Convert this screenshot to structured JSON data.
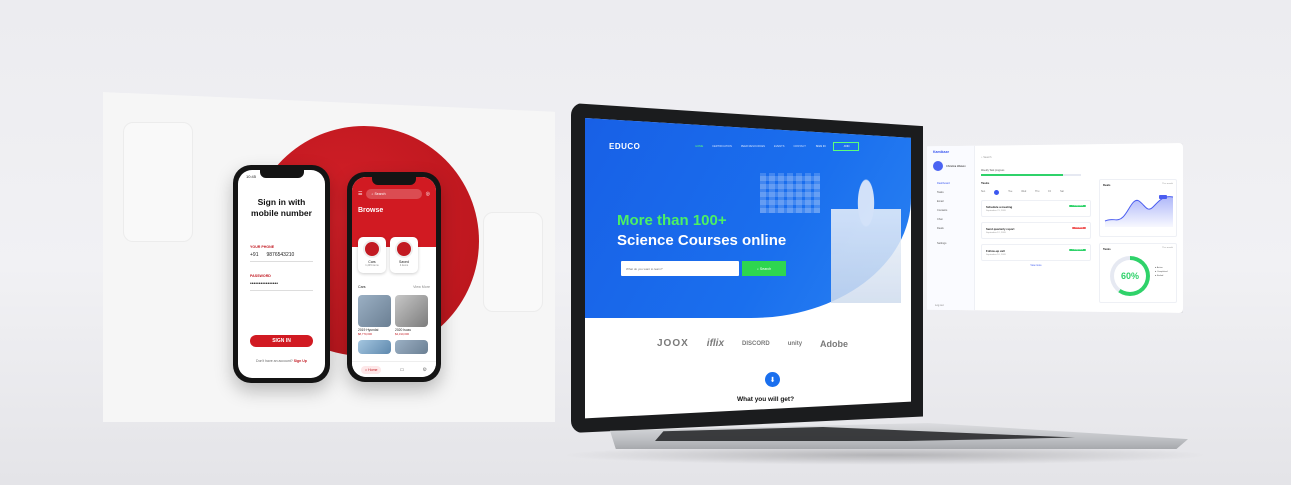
{
  "phones": {
    "signin": {
      "status_time": "10:45",
      "title": "Sign in with mobile number",
      "phone_label": "YOUR PHONE",
      "country_code": "+91",
      "phone_value": "9876543210",
      "password_label": "PASSWORD",
      "password_value": "••••••••••••••••",
      "button": "SIGN IN",
      "footer_text": "Don't have an account?",
      "footer_link": "Sign Up"
    },
    "browse": {
      "status_time": "10:45",
      "search_placeholder": "Search",
      "title": "Browse",
      "categories": [
        {
          "label": "Cars",
          "sub": "1,245 items"
        },
        {
          "label": "Saved",
          "sub": "4 items"
        }
      ],
      "section_title": "Cars",
      "section_link": "View More",
      "cars": [
        {
          "name": "2019 Hyundai",
          "price": "$8,770,000"
        },
        {
          "name": "2020 Isuzu",
          "price": "$4,310,000"
        }
      ],
      "nav_home": "Home"
    }
  },
  "website": {
    "logo": "EDUCO",
    "menu": [
      "HOME",
      "CERTIFICATION",
      "PEER RESOURCES",
      "EVENTS",
      "CONTACT"
    ],
    "sign_in": "SIGN IN",
    "join": "JOIN",
    "hero_line1": "More than 100+",
    "hero_line2": "Science Courses online",
    "search_placeholder": "What do you want to learn?",
    "search_button": "Search",
    "partners": [
      "JOOX",
      "iflix",
      "DISCORD",
      "unity",
      "Adobe"
    ],
    "section_title": "What you will get?"
  },
  "dashboard": {
    "logo": "Kamikaze",
    "user_name": "Christina Watson",
    "menu": [
      "Dashboard",
      "Tasks",
      "Email",
      "Contacts",
      "Chat",
      "Deals"
    ],
    "settings": "Settings",
    "logout": "Log out",
    "search": "Search",
    "progress_label": "Weekly Task progress",
    "progress_fraction": 0.82,
    "tasks_heading": "Tasks",
    "week": [
      "Sun",
      "Mon",
      "Tue",
      "Wed",
      "Thu",
      "Fri",
      "Sat"
    ],
    "tasks": [
      {
        "title": "Schedule a meeting",
        "date": "September 21, 2020",
        "badge": "Completed"
      },
      {
        "title": "Send quarterly report",
        "date": "September 12, 2020",
        "badge": "Pending"
      },
      {
        "title": "Follow-up call",
        "date": "September 10, 2020",
        "badge": "Completed"
      }
    ],
    "view_more": "View more",
    "stats_title": "Deals",
    "stats_sub": "This month",
    "tasks_panel_title": "Tasks",
    "tasks_panel_sub": "This month",
    "donut_value": "60%",
    "donut_fraction": 0.6,
    "legend": [
      "Active",
      "Completed",
      "Ended"
    ]
  },
  "colors": {
    "brand_red": "#d11a22",
    "educo_blue": "#1a6fee",
    "educo_green": "#4cf064",
    "dash_accent": "#3b58f0",
    "dash_green": "#2fd26a"
  }
}
